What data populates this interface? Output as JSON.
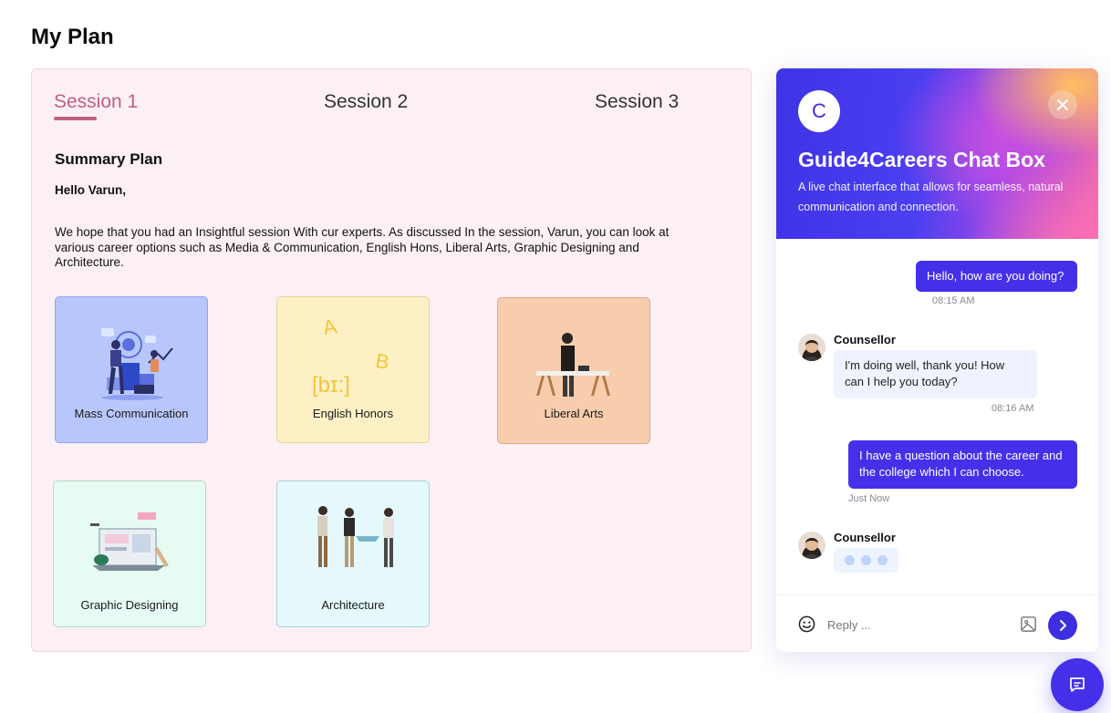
{
  "page": {
    "title": "My Plan"
  },
  "tabs": [
    {
      "label": "Session 1",
      "active": true
    },
    {
      "label": "Session 2",
      "active": false
    },
    {
      "label": "Session 3",
      "active": false
    }
  ],
  "summary": {
    "title": "Summary Plan",
    "greeting": "Hello Varun,",
    "body": "We hope that you had an Insightful session With cur experts. As discussed In the session, Varun, you can look at various career options such as Media & Communication, English Hons, Liberal Arts, Graphic Designing and Architecture."
  },
  "cards": [
    {
      "label": "Mass Communication",
      "color": "#b8c7fb",
      "illustration": "people-analytics-illustration"
    },
    {
      "label": "English Honors",
      "color": "#fdf0c4",
      "illustration": "phonetics-illustration",
      "glyphs": [
        "A",
        "B",
        "[bɪ:]"
      ]
    },
    {
      "label": "Liberal Arts",
      "color": "#f7cdae",
      "illustration": "person-at-desk-illustration"
    },
    {
      "label": "Graphic Designing",
      "color": "#e6fbf1",
      "illustration": "design-laptop-illustration"
    },
    {
      "label": "Architecture",
      "color": "#e5f9fc",
      "illustration": "architects-model-illustration"
    }
  ],
  "chat": {
    "avatar_letter": "C",
    "title": "Guide4Careers Chat Box",
    "subtitle": "A live chat interface that allows for seamless, natural communication and connection.",
    "accent": "#4530ea",
    "messages": [
      {
        "from": "user",
        "text": "Hello, how are you doing?",
        "time": "08:15 AM"
      },
      {
        "from": "counsellor",
        "sender": "Counsellor",
        "text": "I'm doing well, thank you! How can I help you today?",
        "time": "08:16 AM"
      },
      {
        "from": "user",
        "text": "I have a question about the career and the college which I can choose.",
        "time": "Just Now"
      }
    ],
    "typing": {
      "sender": "Counsellor"
    },
    "composer": {
      "placeholder": "Reply ..."
    }
  }
}
